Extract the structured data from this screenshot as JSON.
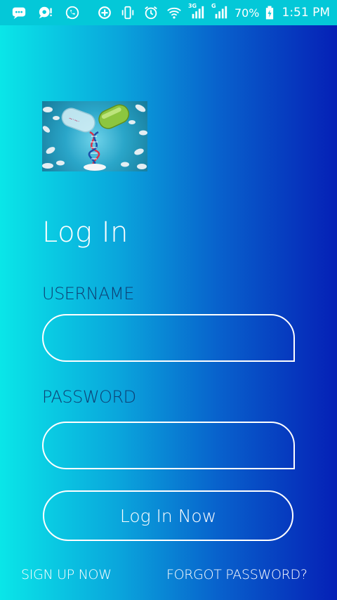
{
  "status_bar": {
    "icons_left": [
      "chat-bubble-icon",
      "sync-chat-icon",
      "whatsapp-icon"
    ],
    "icons_right": [
      "data-saver-icon",
      "vibrate-icon",
      "alarm-icon",
      "wifi-icon",
      "signal-3g-icon",
      "signal-g-icon",
      "battery-icon"
    ],
    "signal_3g_label": "3G",
    "signal_g_label": "G",
    "battery": "70%",
    "time": "1:51 PM"
  },
  "logo": {
    "alt": "Pharmacy capsule with DNA logo"
  },
  "login": {
    "title": "Log In",
    "username_label": "USERNAME",
    "username_value": "",
    "password_label": "PASSWORD",
    "password_value": "",
    "submit_label": "Log In Now"
  },
  "footer": {
    "signup_label": "SIGN UP NOW",
    "forgot_label": "FORGOT PASSWORD?"
  },
  "colors": {
    "gradient_start": "#0ae6e8",
    "gradient_end": "#0520b6",
    "label_color": "#0e3f73",
    "status_bar": "#04c8d8"
  }
}
